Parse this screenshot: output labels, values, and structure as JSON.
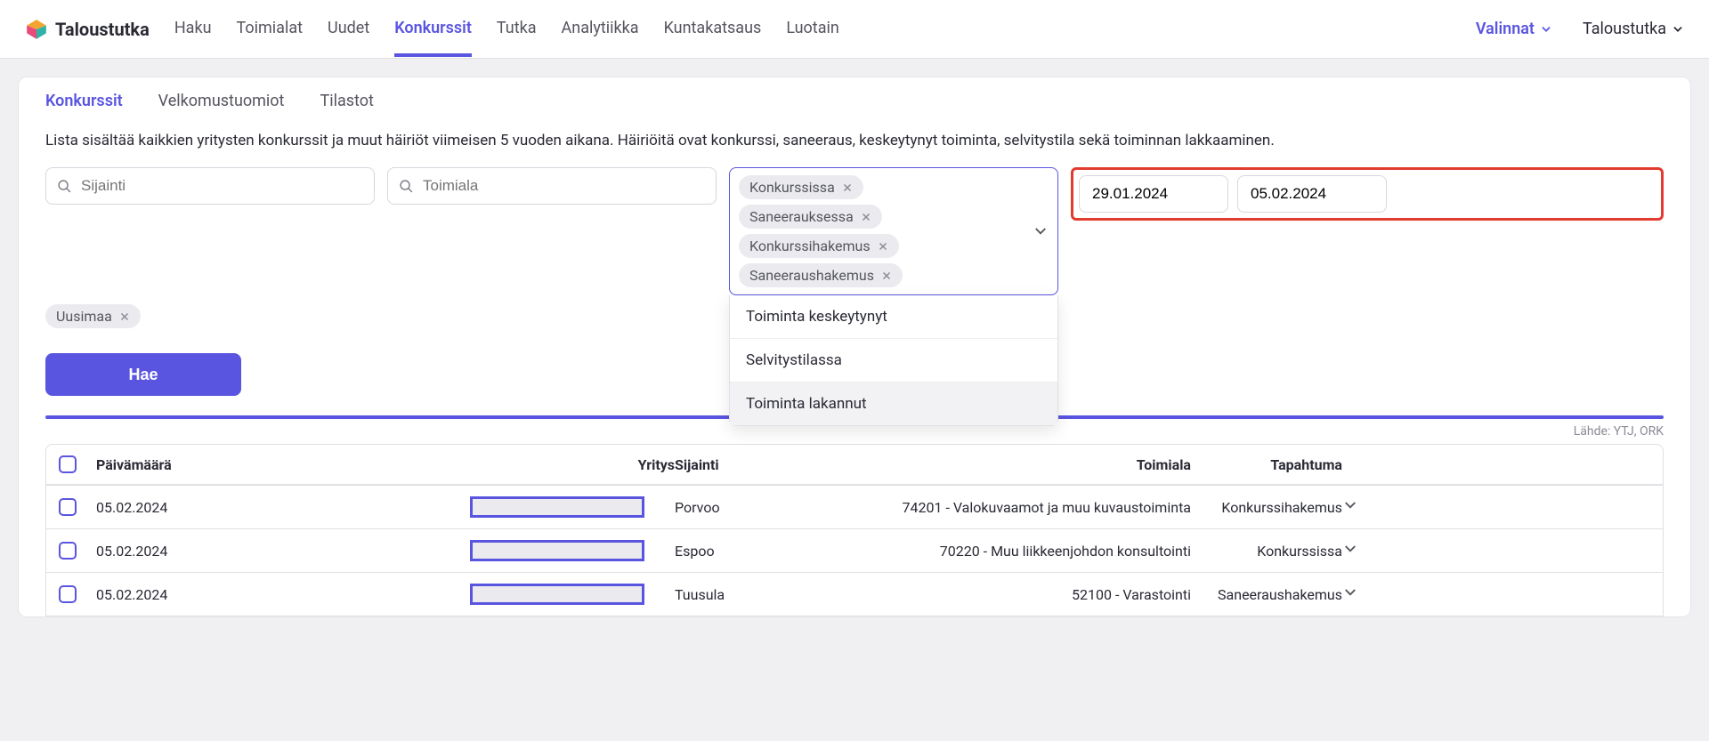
{
  "brand": "Taloustutka",
  "nav": {
    "items": [
      "Haku",
      "Toimialat",
      "Uudet",
      "Konkurssit",
      "Tutka",
      "Analytiikka",
      "Kuntakatsaus",
      "Luotain"
    ],
    "active_index": 3,
    "right": {
      "valinnat": "Valinnat",
      "account": "Taloustutka"
    }
  },
  "subtabs": {
    "items": [
      "Konkurssit",
      "Velkomustuomiot",
      "Tilastot"
    ],
    "active_index": 0
  },
  "description": "Lista sisältää kaikkien yritysten konkurssit ja muut häiriöt viimeisen 5 vuoden aikana. Häiriöitä ovat konkurssi, saneeraus, keskeytynyt toiminta, selvitystila sekä toiminnan lakkaaminen.",
  "filters": {
    "location_placeholder": "Sijainti",
    "industry_placeholder": "Toimiala",
    "selected_statuses": [
      "Konkurssissa",
      "Saneerauksessa",
      "Konkurssihakemus",
      "Saneeraushakemus"
    ],
    "status_options": [
      "Toiminta keskeytynyt",
      "Selvitystilassa",
      "Toiminta lakannut"
    ],
    "hovered_option_index": 2,
    "date_from": "29.01.2024",
    "date_to": "05.02.2024",
    "location_chips": [
      "Uusimaa"
    ]
  },
  "search_button": "Hae",
  "source_label": "Lähde: YTJ, ORK",
  "table": {
    "headers": {
      "date": "Päivämäärä",
      "company": "Yritys",
      "location": "Sijainti",
      "industry": "Toimiala",
      "event": "Tapahtuma"
    },
    "rows": [
      {
        "date": "05.02.2024",
        "location": "Porvoo",
        "industry": "74201 - Valokuvaamot ja muu kuvaustoiminta",
        "event": "Konkurssihakemus"
      },
      {
        "date": "05.02.2024",
        "location": "Espoo",
        "industry": "70220 - Muu liikkeenjohdon konsultointi",
        "event": "Konkurssissa"
      },
      {
        "date": "05.02.2024",
        "location": "Tuusula",
        "industry": "52100 - Varastointi",
        "event": "Saneeraushakemus"
      }
    ]
  }
}
